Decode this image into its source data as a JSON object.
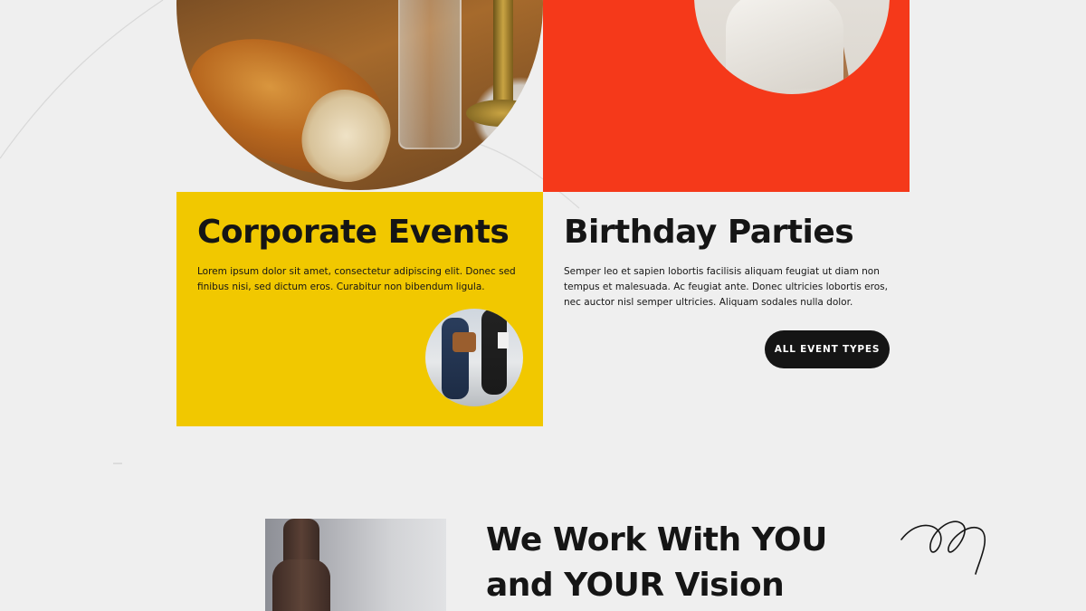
{
  "corporate": {
    "title": "Corporate Events",
    "text": "Lorem ipsum dolor sit amet, consectetur adipiscing elit. Donec sed finibus nisi, sed dictum eros. Curabitur non bibendum ligula."
  },
  "birthday": {
    "title": "Birthday Parties",
    "text": "Semper leo et sapien lobortis facilisis aliquam feugiat ut diam non tempus et malesuada. Ac feugiat ante. Donec ultricies lobortis eros, nec auctor nisl semper ultricies. Aliquam sodales nulla dolor.",
    "button_label": "ALL EVENT TYPES"
  },
  "vision": {
    "title": "We Work With YOU and YOUR Vision"
  },
  "colors": {
    "yellow": "#f1c800",
    "orange": "#f5391a",
    "dark": "#151515",
    "background": "#efefef"
  }
}
